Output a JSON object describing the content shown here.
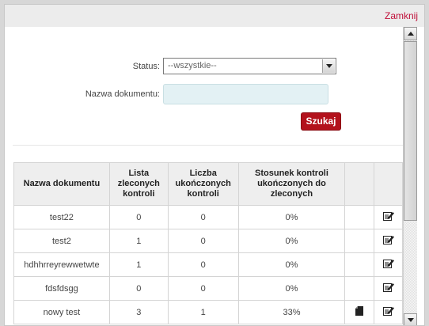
{
  "header": {
    "close_label": "Zamknij"
  },
  "filters": {
    "status_label": "Status:",
    "status_value": "--wszystkie--",
    "doc_name_label": "Nazwa dokumentu:",
    "doc_name_value": "",
    "search_label": "Szukaj"
  },
  "table": {
    "headers": [
      "Nazwa dokumentu",
      "Lista zleconych kontroli",
      "Liczba ukończonych kontroli",
      "Stosunek kontroli ukończonych do zleconych",
      "",
      ""
    ],
    "rows": [
      {
        "name": "test22",
        "ordered": "0",
        "completed": "0",
        "ratio": "0%",
        "has_doc_icon": false
      },
      {
        "name": "test2",
        "ordered": "1",
        "completed": "0",
        "ratio": "0%",
        "has_doc_icon": false
      },
      {
        "name": "hdhhrreyrewwetwte",
        "ordered": "1",
        "completed": "0",
        "ratio": "0%",
        "has_doc_icon": false
      },
      {
        "name": "fdsfdsgg",
        "ordered": "0",
        "completed": "0",
        "ratio": "0%",
        "has_doc_icon": false
      },
      {
        "name": "nowy test",
        "ordered": "3",
        "completed": "1",
        "ratio": "33%",
        "has_doc_icon": true
      }
    ]
  },
  "icons": {
    "doc": "document-icon",
    "edit": "edit-icon"
  },
  "colors": {
    "accent": "#b3121c",
    "link": "#c0113a"
  }
}
